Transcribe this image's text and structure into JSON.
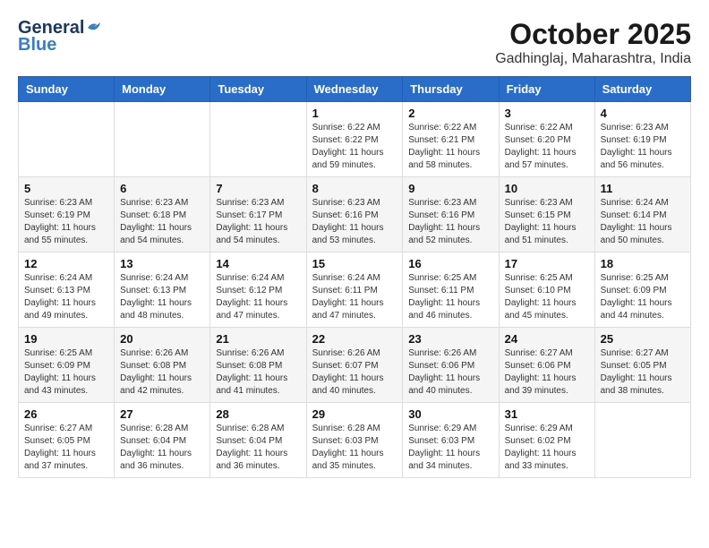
{
  "header": {
    "logo": {
      "general": "General",
      "blue": "Blue"
    },
    "title": "October 2025",
    "subtitle": "Gadhinglaj, Maharashtra, India"
  },
  "calendar": {
    "days_of_week": [
      "Sunday",
      "Monday",
      "Tuesday",
      "Wednesday",
      "Thursday",
      "Friday",
      "Saturday"
    ],
    "weeks": [
      [
        {
          "day": "",
          "info": ""
        },
        {
          "day": "",
          "info": ""
        },
        {
          "day": "",
          "info": ""
        },
        {
          "day": "1",
          "info": "Sunrise: 6:22 AM\nSunset: 6:22 PM\nDaylight: 11 hours\nand 59 minutes."
        },
        {
          "day": "2",
          "info": "Sunrise: 6:22 AM\nSunset: 6:21 PM\nDaylight: 11 hours\nand 58 minutes."
        },
        {
          "day": "3",
          "info": "Sunrise: 6:22 AM\nSunset: 6:20 PM\nDaylight: 11 hours\nand 57 minutes."
        },
        {
          "day": "4",
          "info": "Sunrise: 6:23 AM\nSunset: 6:19 PM\nDaylight: 11 hours\nand 56 minutes."
        }
      ],
      [
        {
          "day": "5",
          "info": "Sunrise: 6:23 AM\nSunset: 6:19 PM\nDaylight: 11 hours\nand 55 minutes."
        },
        {
          "day": "6",
          "info": "Sunrise: 6:23 AM\nSunset: 6:18 PM\nDaylight: 11 hours\nand 54 minutes."
        },
        {
          "day": "7",
          "info": "Sunrise: 6:23 AM\nSunset: 6:17 PM\nDaylight: 11 hours\nand 54 minutes."
        },
        {
          "day": "8",
          "info": "Sunrise: 6:23 AM\nSunset: 6:16 PM\nDaylight: 11 hours\nand 53 minutes."
        },
        {
          "day": "9",
          "info": "Sunrise: 6:23 AM\nSunset: 6:16 PM\nDaylight: 11 hours\nand 52 minutes."
        },
        {
          "day": "10",
          "info": "Sunrise: 6:23 AM\nSunset: 6:15 PM\nDaylight: 11 hours\nand 51 minutes."
        },
        {
          "day": "11",
          "info": "Sunrise: 6:24 AM\nSunset: 6:14 PM\nDaylight: 11 hours\nand 50 minutes."
        }
      ],
      [
        {
          "day": "12",
          "info": "Sunrise: 6:24 AM\nSunset: 6:13 PM\nDaylight: 11 hours\nand 49 minutes."
        },
        {
          "day": "13",
          "info": "Sunrise: 6:24 AM\nSunset: 6:13 PM\nDaylight: 11 hours\nand 48 minutes."
        },
        {
          "day": "14",
          "info": "Sunrise: 6:24 AM\nSunset: 6:12 PM\nDaylight: 11 hours\nand 47 minutes."
        },
        {
          "day": "15",
          "info": "Sunrise: 6:24 AM\nSunset: 6:11 PM\nDaylight: 11 hours\nand 47 minutes."
        },
        {
          "day": "16",
          "info": "Sunrise: 6:25 AM\nSunset: 6:11 PM\nDaylight: 11 hours\nand 46 minutes."
        },
        {
          "day": "17",
          "info": "Sunrise: 6:25 AM\nSunset: 6:10 PM\nDaylight: 11 hours\nand 45 minutes."
        },
        {
          "day": "18",
          "info": "Sunrise: 6:25 AM\nSunset: 6:09 PM\nDaylight: 11 hours\nand 44 minutes."
        }
      ],
      [
        {
          "day": "19",
          "info": "Sunrise: 6:25 AM\nSunset: 6:09 PM\nDaylight: 11 hours\nand 43 minutes."
        },
        {
          "day": "20",
          "info": "Sunrise: 6:26 AM\nSunset: 6:08 PM\nDaylight: 11 hours\nand 42 minutes."
        },
        {
          "day": "21",
          "info": "Sunrise: 6:26 AM\nSunset: 6:08 PM\nDaylight: 11 hours\nand 41 minutes."
        },
        {
          "day": "22",
          "info": "Sunrise: 6:26 AM\nSunset: 6:07 PM\nDaylight: 11 hours\nand 40 minutes."
        },
        {
          "day": "23",
          "info": "Sunrise: 6:26 AM\nSunset: 6:06 PM\nDaylight: 11 hours\nand 40 minutes."
        },
        {
          "day": "24",
          "info": "Sunrise: 6:27 AM\nSunset: 6:06 PM\nDaylight: 11 hours\nand 39 minutes."
        },
        {
          "day": "25",
          "info": "Sunrise: 6:27 AM\nSunset: 6:05 PM\nDaylight: 11 hours\nand 38 minutes."
        }
      ],
      [
        {
          "day": "26",
          "info": "Sunrise: 6:27 AM\nSunset: 6:05 PM\nDaylight: 11 hours\nand 37 minutes."
        },
        {
          "day": "27",
          "info": "Sunrise: 6:28 AM\nSunset: 6:04 PM\nDaylight: 11 hours\nand 36 minutes."
        },
        {
          "day": "28",
          "info": "Sunrise: 6:28 AM\nSunset: 6:04 PM\nDaylight: 11 hours\nand 36 minutes."
        },
        {
          "day": "29",
          "info": "Sunrise: 6:28 AM\nSunset: 6:03 PM\nDaylight: 11 hours\nand 35 minutes."
        },
        {
          "day": "30",
          "info": "Sunrise: 6:29 AM\nSunset: 6:03 PM\nDaylight: 11 hours\nand 34 minutes."
        },
        {
          "day": "31",
          "info": "Sunrise: 6:29 AM\nSunset: 6:02 PM\nDaylight: 11 hours\nand 33 minutes."
        },
        {
          "day": "",
          "info": ""
        }
      ]
    ]
  }
}
